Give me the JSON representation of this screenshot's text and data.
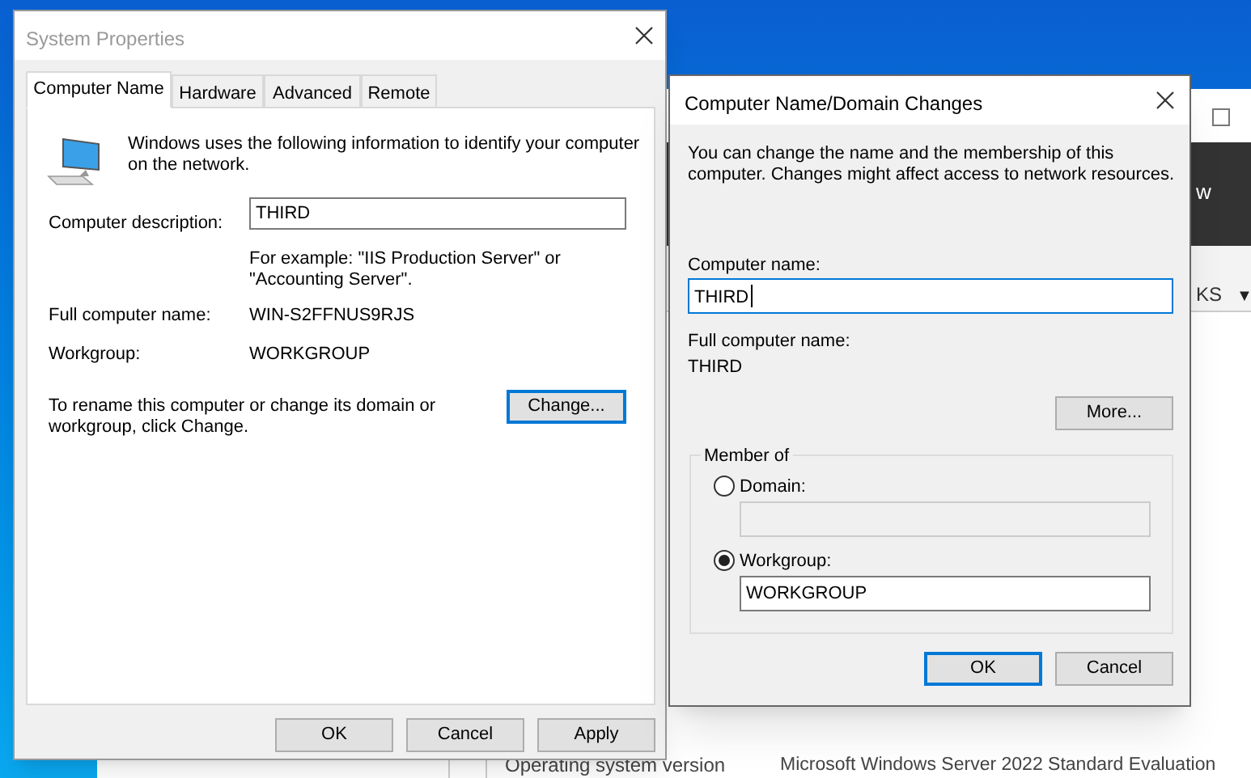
{
  "background_window": {
    "toolbar_text": "w",
    "dropdown_text": "KS",
    "dropdown_arrow": "▼",
    "property_label": "Operating system version",
    "property_value": "Microsoft Windows Server 2022 Standard Evaluation"
  },
  "system_properties": {
    "title": "System Properties",
    "active": false,
    "tabs": [
      {
        "label": "Computer Name",
        "selected": true
      },
      {
        "label": "Hardware",
        "selected": false
      },
      {
        "label": "Advanced",
        "selected": false
      },
      {
        "label": "Remote",
        "selected": false
      }
    ],
    "intro": "Windows uses the following information to identify your computer on the network.",
    "description_label": "Computer description:",
    "description_value": "THIRD",
    "example": "For example: \"IIS Production Server\" or \"Accounting Server\".",
    "full_name_label": "Full computer name:",
    "full_name_value": "WIN-S2FFNUS9RJS",
    "workgroup_label": "Workgroup:",
    "workgroup_value": "WORKGROUP",
    "rename_hint": "To rename this computer or change its domain or workgroup, click Change.",
    "change_button": {
      "label": "Change...",
      "focused": true
    },
    "buttons": [
      {
        "label": "OK",
        "focused": false
      },
      {
        "label": "Cancel",
        "focused": false
      },
      {
        "label": "Apply",
        "focused": false
      }
    ]
  },
  "name_changes": {
    "title": "Computer Name/Domain Changes",
    "active": true,
    "intro": "You can change the name and the membership of this computer. Changes might affect access to network resources.",
    "computer_name_label": "Computer name:",
    "computer_name_value": "THIRD",
    "computer_name_focused": true,
    "full_name_label": "Full computer name:",
    "full_name_value": "THIRD",
    "more_button": {
      "label": "More...",
      "focused": false
    },
    "member_of": {
      "label": "Member of",
      "options": [
        {
          "label": "Domain:",
          "selected": false
        },
        {
          "label": "Workgroup:",
          "selected": true,
          "value": "WORKGROUP"
        }
      ]
    },
    "buttons": [
      {
        "label": "OK",
        "focused": true
      },
      {
        "label": "Cancel",
        "focused": false
      }
    ]
  }
}
